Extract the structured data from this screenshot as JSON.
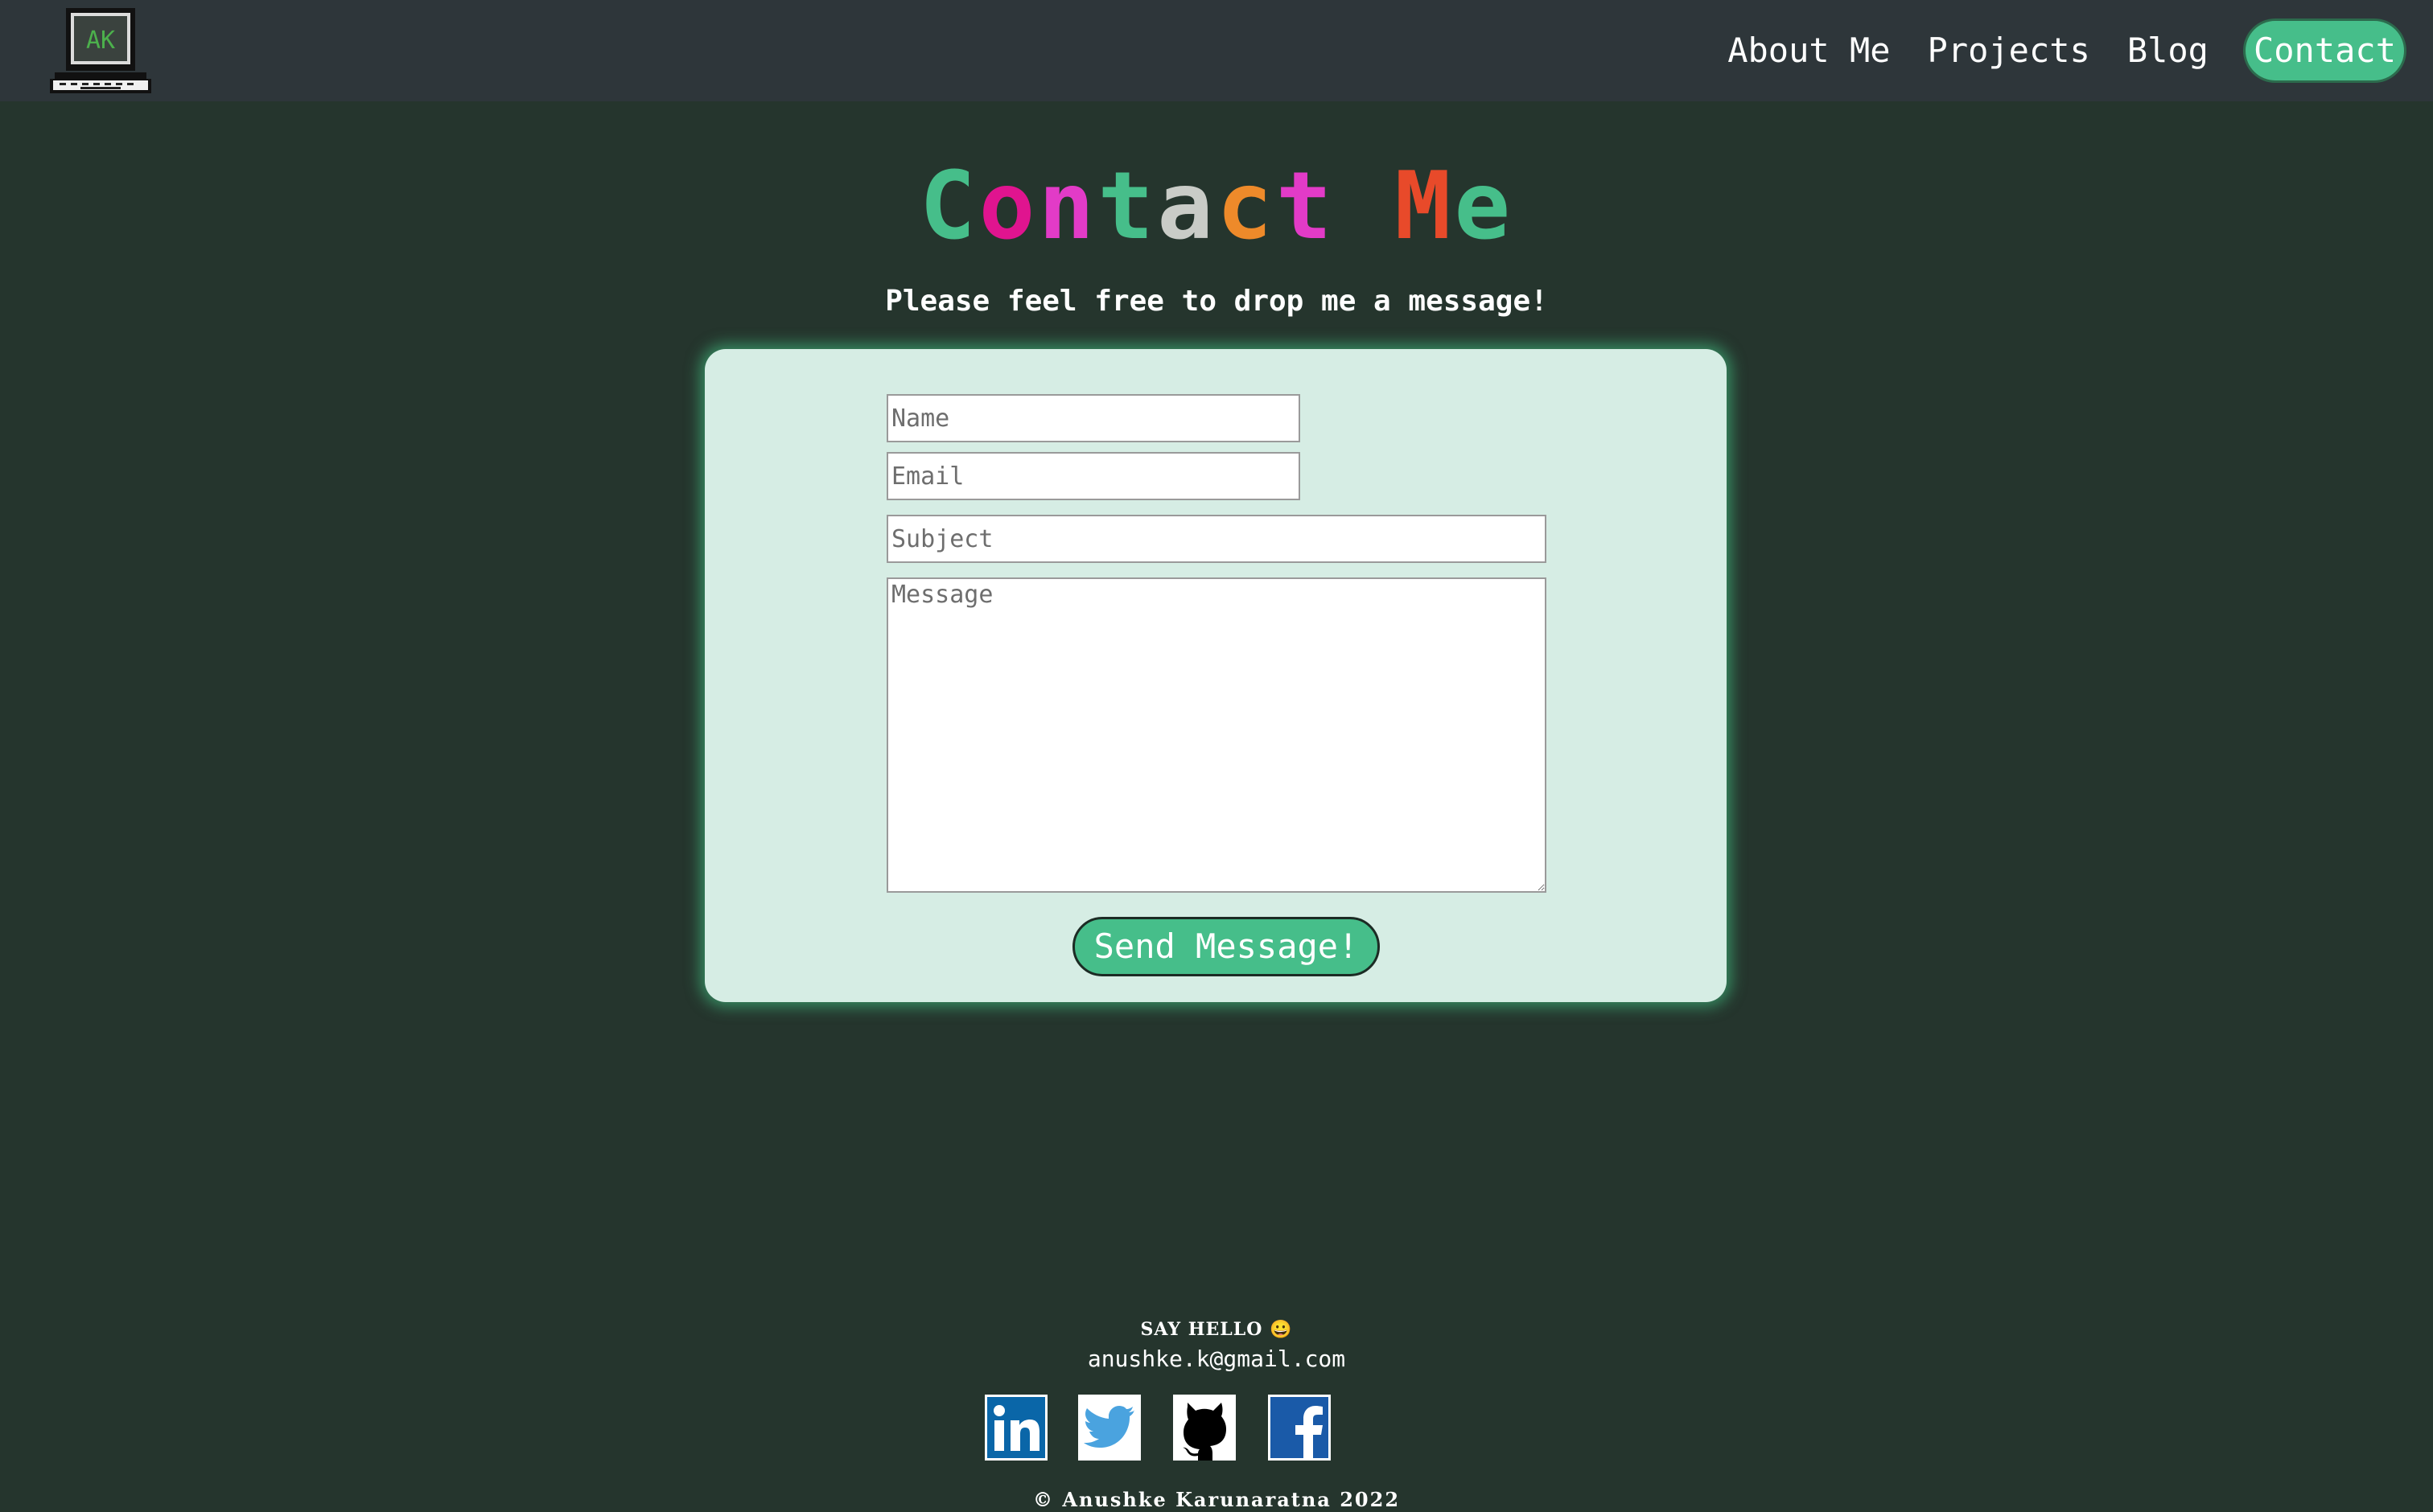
{
  "nav": {
    "logo_text": "AK",
    "items": [
      {
        "label": "About Me",
        "active": false
      },
      {
        "label": "Projects",
        "active": false
      },
      {
        "label": "Blog",
        "active": false
      },
      {
        "label": "Contact",
        "active": true
      }
    ]
  },
  "title": {
    "text": "Contact Me",
    "colors": [
      "#46be8a",
      "#e0148f",
      "#e23bc7",
      "#46be8a",
      "#c9ccc7",
      "#ee8a2a",
      "#e23bc7",
      "#e84a2a",
      "#46be8a",
      "#c9ccc7"
    ]
  },
  "subtitle": "Please feel free to drop me a message!",
  "form": {
    "name_placeholder": "Name",
    "email_placeholder": "Email",
    "subject_placeholder": "Subject",
    "message_placeholder": "Message",
    "submit_label": "Send Message!"
  },
  "footer": {
    "hello": "SAY HELLO 😀",
    "email": "anushke.k@gmail.com",
    "socials": [
      {
        "name": "LinkedIn",
        "icon": "linkedin-icon"
      },
      {
        "name": "Twitter",
        "icon": "twitter-icon"
      },
      {
        "name": "GitHub",
        "icon": "github-icon"
      },
      {
        "name": "Facebook",
        "icon": "facebook-icon"
      }
    ],
    "copyright": "© Anushke Karunaratna 2022"
  },
  "colors": {
    "background": "#25352d",
    "header": "#2e363a",
    "accent": "#46be8a",
    "card": "#d6ede4"
  }
}
